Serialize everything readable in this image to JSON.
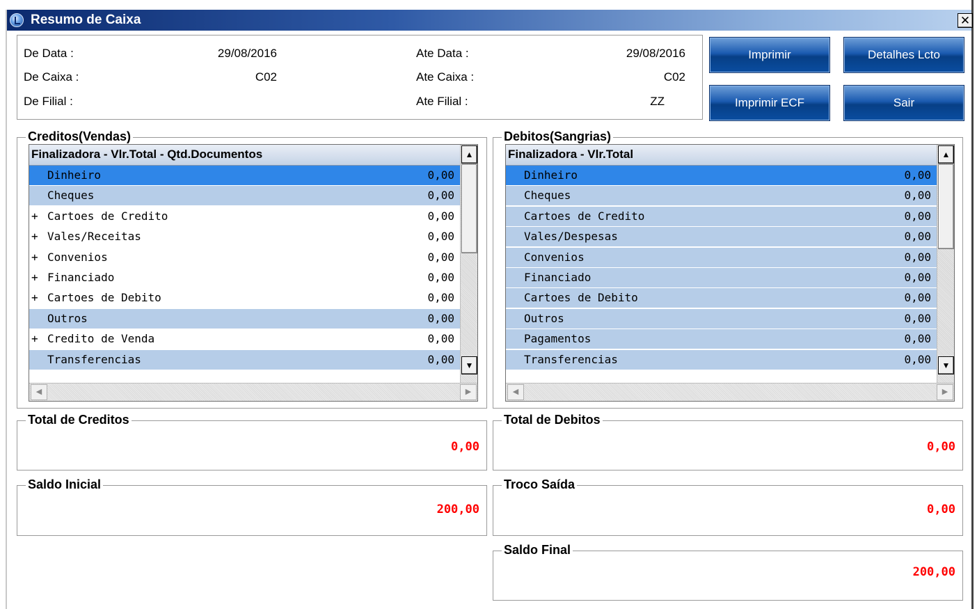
{
  "window": {
    "title": "Resumo de Caixa",
    "close_glyph": "✕"
  },
  "filters": {
    "de_data_label": "De Data  :",
    "de_data_value": "29/08/2016",
    "ate_data_label": "Ate Data  :",
    "ate_data_value": "29/08/2016",
    "de_caixa_label": "De Caixa  :",
    "de_caixa_value": "C02",
    "ate_caixa_label": "Ate Caixa  :",
    "ate_caixa_value": "C02",
    "de_filial_label": "De Filial :",
    "de_filial_value": "",
    "ate_filial_label": "Ate Filial :",
    "ate_filial_value": "ZZ"
  },
  "buttons": {
    "imprimir": "Imprimir",
    "detalhes": "Detalhes Lcto",
    "imprimir_ecf": "Imprimir ECF",
    "sair": "Sair"
  },
  "creditos": {
    "legend": "Creditos(Vendas)",
    "header": "Finalizadora - Vlr.Total - Qtd.Documentos",
    "rows": [
      {
        "prefix": "",
        "name": "Dinheiro",
        "value": "0,00"
      },
      {
        "prefix": "",
        "name": "Cheques",
        "value": "0,00"
      },
      {
        "prefix": "+",
        "name": "Cartoes de Credito",
        "value": "0,00"
      },
      {
        "prefix": "+",
        "name": "Vales/Receitas",
        "value": "0,00"
      },
      {
        "prefix": "+",
        "name": "Convenios",
        "value": "0,00"
      },
      {
        "prefix": "+",
        "name": "Financiado",
        "value": "0,00"
      },
      {
        "prefix": "+",
        "name": "Cartoes de Debito",
        "value": "0,00"
      },
      {
        "prefix": "",
        "name": "Outros",
        "value": "0,00"
      },
      {
        "prefix": "+",
        "name": "Credito de Venda",
        "value": "0,00"
      },
      {
        "prefix": "",
        "name": "Transferencias",
        "value": "0,00"
      }
    ]
  },
  "debitos": {
    "legend": "Debitos(Sangrias)",
    "header": "Finalizadora - Vlr.Total",
    "rows": [
      {
        "prefix": "",
        "name": "Dinheiro",
        "value": "0,00"
      },
      {
        "prefix": "",
        "name": "Cheques",
        "value": "0,00"
      },
      {
        "prefix": "",
        "name": "Cartoes de Credito",
        "value": "0,00"
      },
      {
        "prefix": "",
        "name": "Vales/Despesas",
        "value": "0,00"
      },
      {
        "prefix": "",
        "name": "Convenios",
        "value": "0,00"
      },
      {
        "prefix": "",
        "name": "Financiado",
        "value": "0,00"
      },
      {
        "prefix": "",
        "name": "Cartoes de Debito",
        "value": "0,00"
      },
      {
        "prefix": "",
        "name": "Outros",
        "value": "0,00"
      },
      {
        "prefix": "",
        "name": "Pagamentos",
        "value": "0,00"
      },
      {
        "prefix": "",
        "name": "Transferencias",
        "value": "0,00"
      }
    ]
  },
  "totals": {
    "total_creditos_label": "Total de Creditos",
    "total_creditos_value": "0,00",
    "total_debitos_label": "Total de Debitos",
    "total_debitos_value": "0,00",
    "saldo_inicial_label": "Saldo Inicial",
    "saldo_inicial_value": "200,00",
    "troco_saida_label": "Troco Saída",
    "troco_saida_value": "0,00",
    "saldo_final_label": "Saldo Final",
    "saldo_final_value": "200,00"
  },
  "scroll_glyphs": {
    "up": "▲",
    "down": "▼",
    "left": "◀",
    "right": "▶"
  },
  "colors": {
    "value_red": "#ff0000",
    "row_blue": "#b6cde8",
    "row_selected": "#2f86e8",
    "button_blue": "#0a4da0"
  }
}
